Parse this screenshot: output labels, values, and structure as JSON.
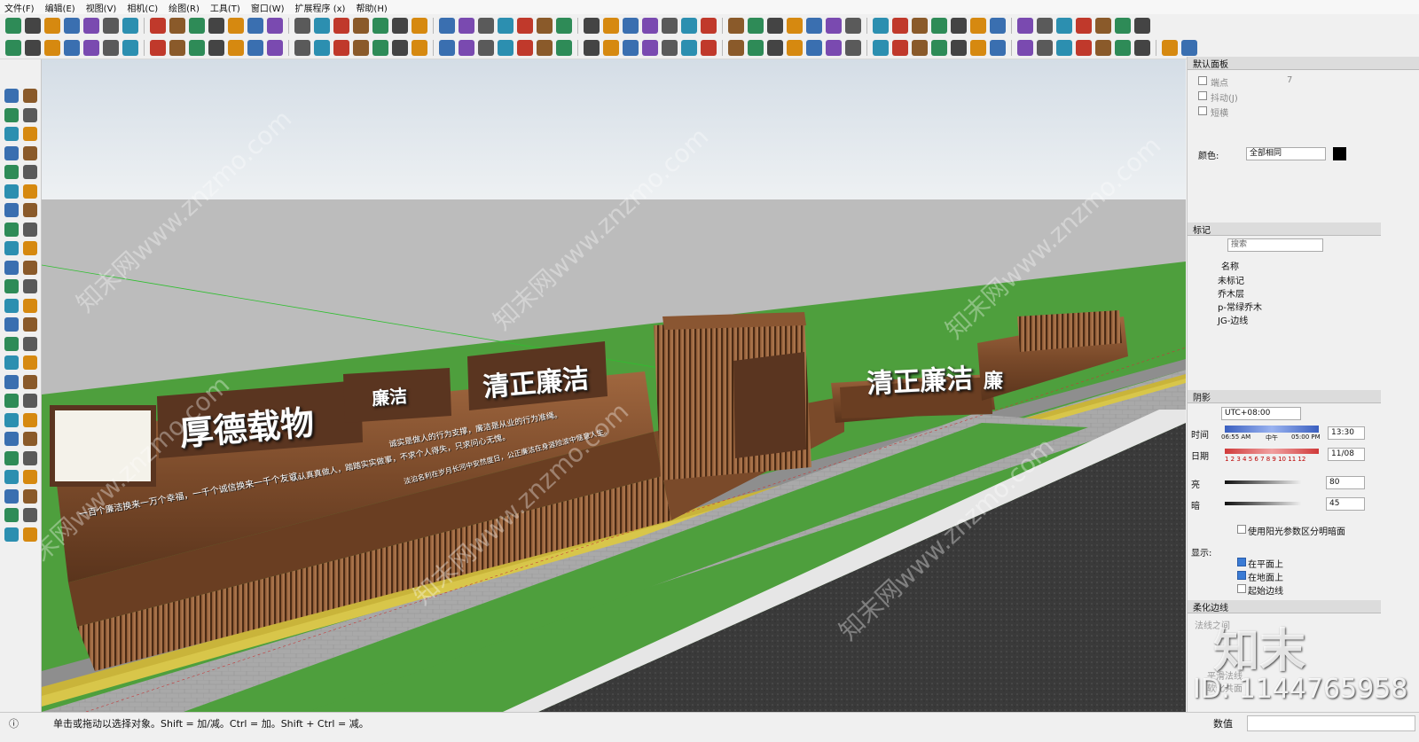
{
  "menu": [
    "文件(F)",
    "编辑(E)",
    "视图(V)",
    "相机(C)",
    "绘图(R)",
    "工具(T)",
    "窗口(W)",
    "扩展程序 (x)",
    "帮助(H)"
  ],
  "scene": {
    "signs": [
      "厚德载物",
      "清正廉洁",
      "清正廉洁"
    ],
    "small_signs": [
      "廉洁",
      "廉"
    ],
    "slogans": [
      "一百个廉洁换来一万个幸福，一千个诚信换来一千个友谊。",
      "认认真真做人，踏踏实实做事，不求个人得失，只求问心无愧。",
      "诚实是做人的行为支撑，廉洁是从业的行为准绳。",
      "淡泊名利在岁月长河中安然度日，公正廉洁在身涯险波中惬意人生。"
    ],
    "watermarks": [
      "知末网www.znzmo.com",
      "知末网www.znzmo.com",
      "知末网www.znzmo.com",
      "知末网www.znzmo.com",
      "知末网www.znzmo.com",
      "知末网www.znzmo.com"
    ]
  },
  "panel": {
    "default_title": "默认面板",
    "style_items": [
      {
        "label": "端点",
        "value": "7"
      },
      {
        "label": "抖动(J)",
        "value": ""
      },
      {
        "label": "短横",
        "value": ""
      }
    ],
    "color_label": "颜色:",
    "color_value": "全部相同",
    "tags_title": "标记",
    "search_placeholder": "搜索",
    "name_header": "名称",
    "tags": [
      "未标记",
      "乔木层",
      "p-常绿乔木",
      "JG-边线"
    ],
    "shadow_title": "阴影",
    "timezone": "UTC+08:00",
    "time_label": "时间",
    "time_start": "06:55 AM",
    "time_mid": "中午",
    "time_end": "05:00 PM",
    "time_value": "13:30",
    "date_label": "日期",
    "months": "1 2 3 4 5 6 7 8 9 10 11 12",
    "date_value": "11/08",
    "light_label": "亮",
    "light_value": "80",
    "dark_label": "暗",
    "dark_value": "45",
    "sun_shading": "使用阳光参数区分明暗面",
    "display_label": "显示:",
    "display_items": [
      {
        "label": "在平面上",
        "checked": true
      },
      {
        "label": "在地面上",
        "checked": true
      },
      {
        "label": "起始边线",
        "checked": false
      }
    ],
    "soften_title": "柔化边线",
    "soften_items": [
      "法线之间",
      "平滑法线",
      "软化共面"
    ]
  },
  "status": {
    "hint": "单击或拖动以选择对象。Shift = 加/减。Ctrl = 加。Shift + Ctrl = 减。",
    "value_label": "数值"
  },
  "brand": {
    "logo": "知末",
    "id": "ID: 1144765958"
  }
}
